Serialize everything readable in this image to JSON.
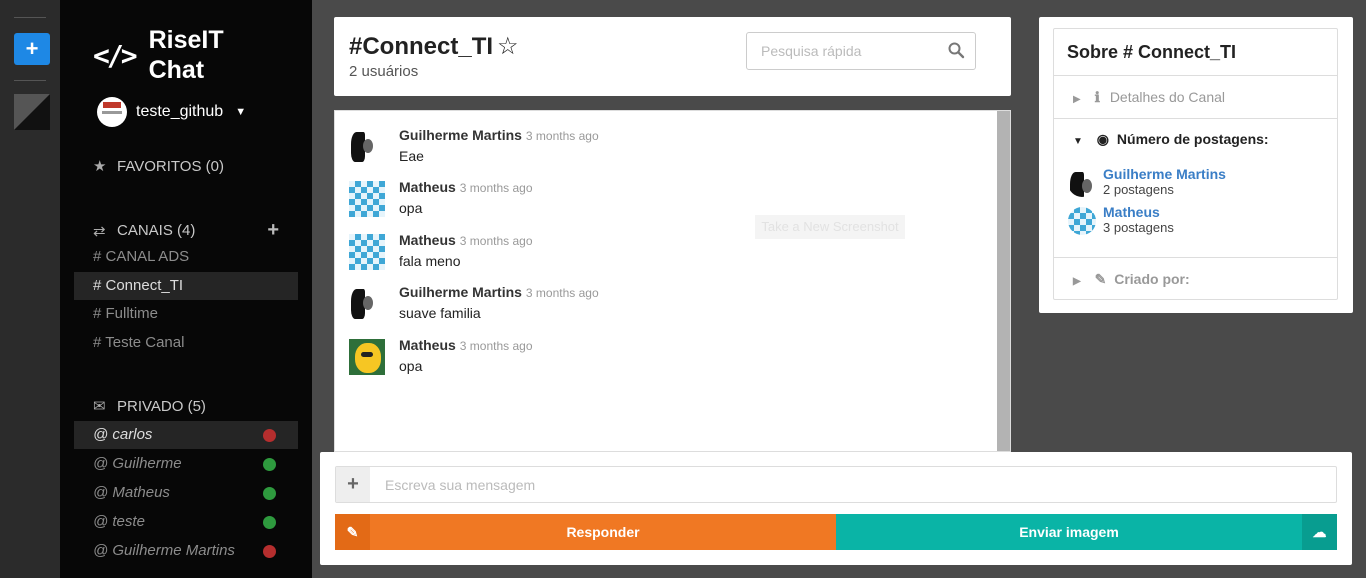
{
  "app": {
    "brand_line1": "RiseIT",
    "brand_line2": "Chat",
    "username": "teste_github"
  },
  "sidebar": {
    "favorites_label": "FAVORITOS (0)",
    "channels_label": "CANAIS (4)",
    "channels": [
      {
        "label": "# CANAL ADS"
      },
      {
        "label": "# Connect_TI"
      },
      {
        "label": "# Fulltime"
      },
      {
        "label": "# Teste Canal"
      }
    ],
    "private_label": "PRIVADO (5)",
    "private": [
      {
        "label": "@ carlos",
        "status": "offline",
        "status_color": "#b52e2e"
      },
      {
        "label": "@ Guilherme",
        "status": "online",
        "status_color": "#2e9a3e"
      },
      {
        "label": "@ Matheus",
        "status": "online",
        "status_color": "#2e9a3e"
      },
      {
        "label": "@ teste",
        "status": "online",
        "status_color": "#2e9a3e"
      },
      {
        "label": "@ Guilherme Martins",
        "status": "offline",
        "status_color": "#b52e2e"
      }
    ]
  },
  "header": {
    "title": "#Connect_TI",
    "users": "2 usuários",
    "search_placeholder": "Pesquisa rápida"
  },
  "messages": [
    {
      "author": "Guilherme Martins",
      "time": "3 months ago",
      "text": "Eae",
      "avatar": "bw-portrait"
    },
    {
      "author": "Matheus",
      "time": "3 months ago",
      "text": "opa",
      "avatar": "geometric"
    },
    {
      "author": "Matheus",
      "time": "3 months ago",
      "text": "fala meno",
      "avatar": "geometric"
    },
    {
      "author": "Guilherme Martins",
      "time": "3 months ago",
      "text": "suave familia",
      "avatar": "bw-portrait"
    },
    {
      "author": "Matheus",
      "time": "3 months ago",
      "text": "opa",
      "avatar": "cartoon"
    }
  ],
  "overlay_text": "Take a New Screenshot",
  "composer": {
    "placeholder": "Escreva sua mensagem",
    "reply_label": "Responder",
    "image_label": "Enviar imagem"
  },
  "right_panel": {
    "title": "Sobre # Connect_TI",
    "details_label": "Detalhes do Canal",
    "posts_label": "Número de postagens:",
    "posters": [
      {
        "name": "Guilherme Martins",
        "count": "2 postagens",
        "avatar": "bw-portrait"
      },
      {
        "name": "Matheus",
        "count": "3 postagens",
        "avatar": "geometric"
      }
    ],
    "created_label": "Criado por:"
  },
  "colors": {
    "accent_blue": "#1e88e5",
    "reply_orange": "#f07823",
    "image_teal": "#0ab4a6",
    "link_blue": "#3a7ec6"
  }
}
